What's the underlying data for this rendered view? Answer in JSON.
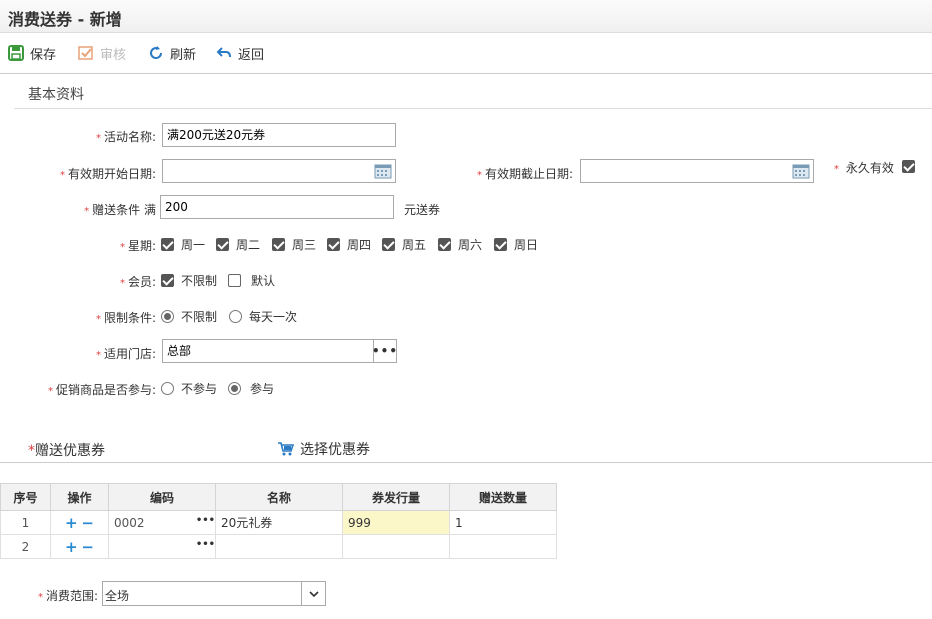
{
  "page": {
    "title": "消费送券 - 新增"
  },
  "toolbar": {
    "save": "保存",
    "audit": "审核",
    "refresh": "刷新",
    "back": "返回"
  },
  "basic": {
    "section_title": "基本资料",
    "activity_name_label": "活动名称:",
    "activity_name_value": "满200元送20元券",
    "start_date_label": "有效期开始日期:",
    "start_date_value": "",
    "end_date_label": "有效期截止日期:",
    "end_date_value": "",
    "forever_label": "永久有效",
    "forever_checked": true,
    "condition_label": "赠送条件 满",
    "condition_value": "200",
    "condition_suffix": "元送券",
    "week_label": "星期:",
    "weekdays": [
      "周一",
      "周二",
      "周三",
      "周四",
      "周五",
      "周六",
      "周日"
    ],
    "member_label": "会员:",
    "member_unlimited": "不限制",
    "member_default": "默认",
    "limit_label": "限制条件:",
    "limit_unlimited": "不限制",
    "limit_daily": "每天一次",
    "store_label": "适用门店:",
    "store_value": "总部",
    "promo_label": "促销商品是否参与:",
    "promo_no": "不参与",
    "promo_yes": "参与"
  },
  "coupons": {
    "title": "赠送优惠券",
    "title_star": "*",
    "pick": "选择优惠券",
    "columns": [
      "序号",
      "操作",
      "编码",
      "名称",
      "券发行量",
      "赠送数量"
    ],
    "rows": [
      {
        "seq": "1",
        "code": "0002",
        "name": "20元礼券",
        "issue": "999",
        "qty": "1"
      },
      {
        "seq": "2",
        "code": "",
        "name": "",
        "issue": "",
        "qty": ""
      }
    ]
  },
  "scope": {
    "label": "消费范围:",
    "value": "全场"
  },
  "colors": {
    "accent": "#2a8ad4",
    "required": "#e04040",
    "highlight": "#fbf7c8"
  }
}
